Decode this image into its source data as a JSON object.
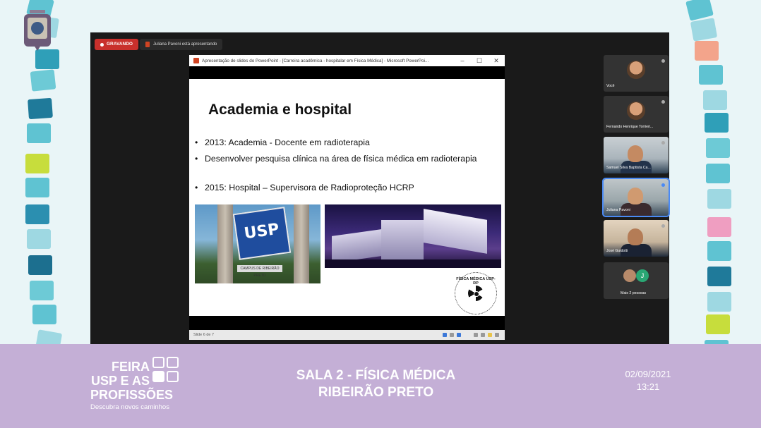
{
  "recording": {
    "label": "GRAVANDO"
  },
  "presenting": {
    "text": "Juliana Pavoni está apresentando"
  },
  "ppt_window": {
    "title": "Apresentação de slides do PowerPoint - [Carreira acadêmica - hospitalar em Física Médica] - Microsoft PowerPoi...",
    "minimize": "–",
    "maximize": "☐",
    "close": "✕",
    "status_left": "Slide 6 de 7"
  },
  "slide": {
    "heading": "Academia e hospital",
    "bullets": [
      "2013: Academia - Docente em radioterapia",
      "Desenvolver pesquisa clínica na área de física médica em radioterapia",
      "2015: Hospital – Supervisora de Radioproteção HCRP"
    ],
    "bullet_char": "•",
    "usp_sign": "USP",
    "campus_plaque": "CAMPUS DE RIBEIRÃO PRETO",
    "stamp_text": "FÍSICA MÉDICA USP-RP"
  },
  "participants": [
    {
      "name": "Você"
    },
    {
      "name": "Fernando Henrique Torrieri..."
    },
    {
      "name": "Samuel Silva Baptista Ca..."
    },
    {
      "name": "Juliana Pavoni"
    },
    {
      "name": "José Guidotti"
    }
  ],
  "more_participants": {
    "label": "Mais 2 pessoas",
    "avatar_letter": "J"
  },
  "banner": {
    "feira_line1": "FEIRA",
    "feira_line2": "USP E AS",
    "feira_line3": "PROFISSÕES",
    "feira_tagline": "Descubra novos caminhos",
    "room_line1": "SALA 2 - FÍSICA MÉDICA",
    "room_line2": "RIBEIRÃO PRETO",
    "date": "02/09/2021",
    "time": "13:21"
  },
  "colors": {
    "recording": "#c9302c",
    "banner": "#c4afd6",
    "active_speaker": "#4a8af4",
    "usp_blue": "#1f4d9e"
  }
}
